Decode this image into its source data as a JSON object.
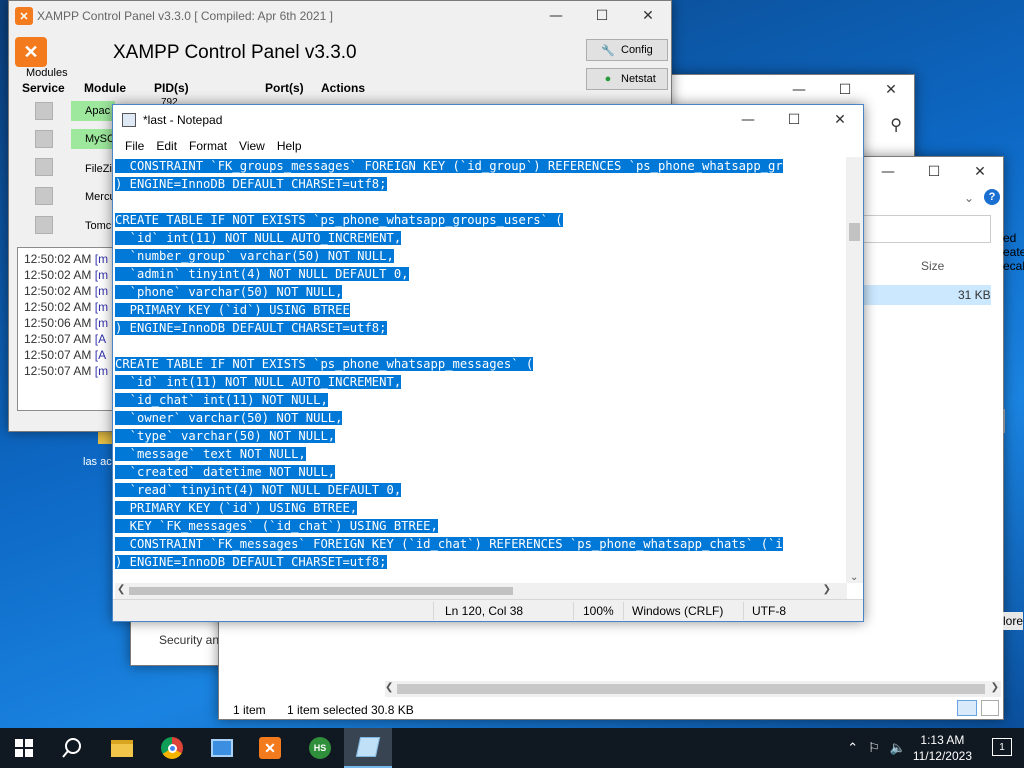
{
  "xampp": {
    "title": "XAMPP Control Panel v3.3.0   [ Compiled: Apr 6th 2021 ]",
    "heading": "XAMPP Control Panel v3.3.0",
    "modules_label": "Modules",
    "columns": {
      "service": "Service",
      "module": "Module",
      "pid": "PID(s)",
      "port": "Port(s)",
      "actions": "Actions"
    },
    "buttons": {
      "config": "Config",
      "netstat": "Netstat"
    },
    "modules": [
      {
        "name": "Apac",
        "pid": "792",
        "running": true
      },
      {
        "name": "MySC",
        "pid": "",
        "running": true
      },
      {
        "name": "FileZi",
        "pid": "",
        "running": false
      },
      {
        "name": "Mercu",
        "pid": "",
        "running": false
      },
      {
        "name": "Tomc",
        "pid": "",
        "running": false
      }
    ],
    "log": [
      {
        "time": "12:50:02 AM",
        "tag": "[m"
      },
      {
        "time": "12:50:02 AM",
        "tag": "[m"
      },
      {
        "time": "12:50:02 AM",
        "tag": "[m"
      },
      {
        "time": "12:50:02 AM",
        "tag": "[m"
      },
      {
        "time": "12:50:06 AM",
        "tag": "[m"
      },
      {
        "time": "12:50:07 AM",
        "tag": "[A"
      },
      {
        "time": "12:50:07 AM",
        "tag": "[A"
      },
      {
        "time": "12:50:07 AM",
        "tag": "[m"
      }
    ]
  },
  "desktop_icon_label": "las ac",
  "explorer_back": {
    "partial_label": "Security an"
  },
  "explorer": {
    "size_column": "Size",
    "file_size": "31 KB",
    "status_items": "1 item",
    "status_selected": "1 item selected  30.8 KB",
    "side_text": [
      "ed",
      "eate",
      "ecal"
    ],
    "more": "lore"
  },
  "notepad": {
    "title": "*last - Notepad",
    "menu": [
      "File",
      "Edit",
      "Format",
      "View",
      "Help"
    ],
    "lines": [
      "  CONSTRAINT `FK_groups_messages` FOREIGN KEY (`id_group`) REFERENCES `ps_phone_whatsapp_gr",
      ") ENGINE=InnoDB DEFAULT CHARSET=utf8;",
      "",
      "CREATE TABLE IF NOT EXISTS `ps_phone_whatsapp_groups_users` (",
      "  `id` int(11) NOT NULL AUTO_INCREMENT,",
      "  `number_group` varchar(50) NOT NULL,",
      "  `admin` tinyint(4) NOT NULL DEFAULT 0,",
      "  `phone` varchar(50) NOT NULL,",
      "  PRIMARY KEY (`id`) USING BTREE",
      ") ENGINE=InnoDB DEFAULT CHARSET=utf8;",
      "",
      "CREATE TABLE IF NOT EXISTS `ps_phone_whatsapp_messages` (",
      "  `id` int(11) NOT NULL AUTO_INCREMENT,",
      "  `id_chat` int(11) NOT NULL,",
      "  `owner` varchar(50) NOT NULL,",
      "  `type` varchar(50) NOT NULL,",
      "  `message` text NOT NULL,",
      "  `created` datetime NOT NULL,",
      "  `read` tinyint(4) NOT NULL DEFAULT 0,",
      "  PRIMARY KEY (`id`) USING BTREE,",
      "  KEY `FK_messages` (`id_chat`) USING BTREE,",
      "  CONSTRAINT `FK_messages` FOREIGN KEY (`id_chat`) REFERENCES `ps_phone_whatsapp_chats` (`i",
      ") ENGINE=InnoDB DEFAULT CHARSET=utf8;"
    ],
    "status": {
      "position": "Ln 120, Col 38",
      "zoom": "100%",
      "line_ending": "Windows (CRLF)",
      "encoding": "UTF-8"
    }
  },
  "taskbar": {
    "time": "1:13 AM",
    "date": "11/12/2023",
    "notification_count": "1",
    "apps": [
      "file-explorer-icon",
      "chrome-icon",
      "control-panel-icon",
      "xampp-icon",
      "heidisql-icon",
      "notepad-icon"
    ]
  },
  "colors": {
    "selection": "#0078d7",
    "xampp_orange": "#f37b1d",
    "taskbar": "#101822"
  }
}
